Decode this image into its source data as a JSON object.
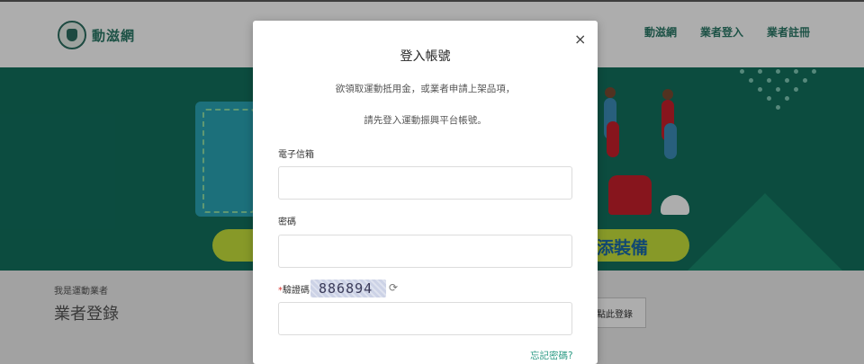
{
  "header": {
    "logo_text": "動滋網",
    "nav": [
      "動滋網",
      "業者登入",
      "業者註冊"
    ]
  },
  "banner": {
    "pill_text": "添裝備"
  },
  "vendor_section": {
    "small_label": "我是運動業者",
    "title": "業者登錄",
    "button_label": "點此登錄"
  },
  "modal": {
    "title": "登入帳號",
    "close_label": "×",
    "desc_line1": "欲領取運動抵用金，或業者申請上架品項，",
    "desc_line2": "請先登入運動振興平台帳號。",
    "email_label": "電子信箱",
    "email_value": "",
    "password_label": "密碼",
    "password_value": "",
    "captcha_required_mark": "*",
    "captcha_label": "驗證碼",
    "captcha_code": "886894",
    "captcha_value": "",
    "forgot_password": "忘記密碼?"
  },
  "colors": {
    "brand": "#2c7a68",
    "banner_bg": "#12705e",
    "link": "#2c9a84"
  }
}
